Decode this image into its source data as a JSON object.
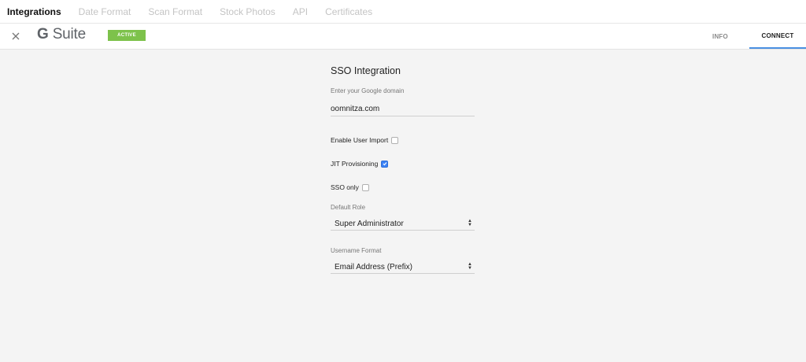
{
  "topnav": {
    "tabs": [
      {
        "label": "Integrations",
        "active": true
      },
      {
        "label": "Date Format",
        "active": false
      },
      {
        "label": "Scan Format",
        "active": false
      },
      {
        "label": "Stock Photos",
        "active": false
      },
      {
        "label": "API",
        "active": false
      },
      {
        "label": "Certificates",
        "active": false
      }
    ]
  },
  "header": {
    "close_icon": "close-icon",
    "brand_g": "G",
    "brand_name": "Suite",
    "badge": "ACTIVE",
    "tab_info": "INFO",
    "tab_connect": "CONNECT",
    "accent_color": "#4a90e2",
    "badge_color": "#7dc24b"
  },
  "form": {
    "title": "SSO Integration",
    "domain_label": "Enter your Google domain",
    "domain_value": "oomnitza.com",
    "enable_user_import": {
      "label": "Enable User Import",
      "checked": false
    },
    "jit_provisioning": {
      "label": "JIT Provisioning",
      "checked": true
    },
    "sso_only": {
      "label": "SSO only",
      "checked": false
    },
    "default_role_label": "Default Role",
    "default_role_value": "Super Administrator",
    "username_format_label": "Username Format",
    "username_format_value": "Email Address (Prefix)"
  }
}
